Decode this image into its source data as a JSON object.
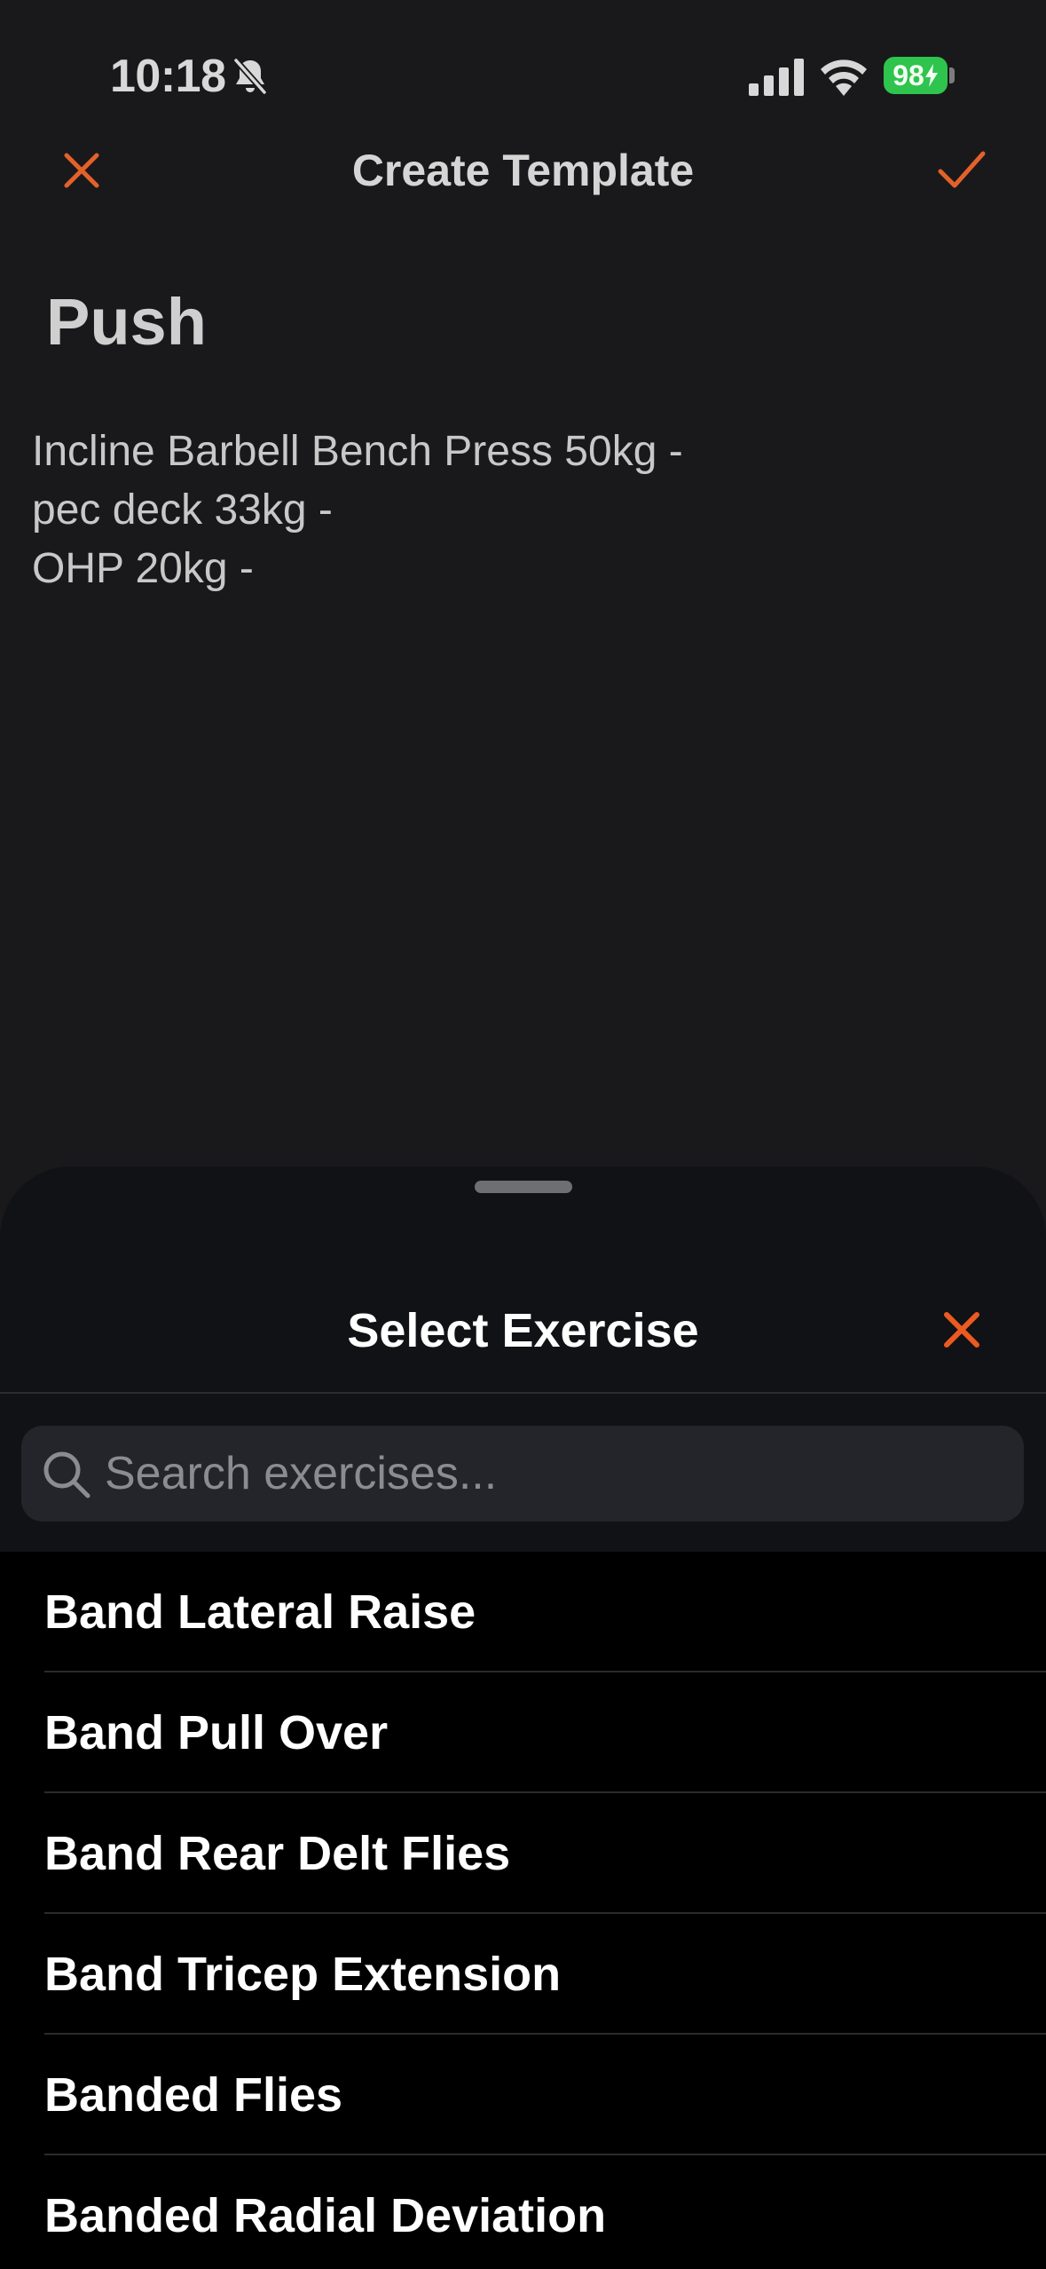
{
  "status_bar": {
    "time": "10:18",
    "battery": "98",
    "icons": [
      "bell-slash-icon",
      "signal-icon",
      "wifi-icon",
      "battery-charging-icon"
    ]
  },
  "nav": {
    "title": "Create Template",
    "close_icon": "close-icon",
    "done_icon": "checkmark-icon"
  },
  "template": {
    "name": "Push",
    "notes": [
      "Incline Barbell Bench Press 50kg -",
      "pec deck 33kg -",
      "OHP 20kg -"
    ]
  },
  "sheet": {
    "title": "Select Exercise",
    "close_icon": "close-icon",
    "search": {
      "placeholder": "Search exercises...",
      "value": ""
    },
    "exercises": [
      "Band Lateral Raise",
      "Band Pull Over",
      "Band Rear Delt Flies",
      "Band Tricep Extension",
      "Banded Flies",
      "Banded Radial Deviation"
    ]
  },
  "colors": {
    "accent": "#e4612a",
    "background": "#19191b",
    "sheet": "#101216",
    "list": "#000000",
    "battery": "#2fc44d"
  }
}
